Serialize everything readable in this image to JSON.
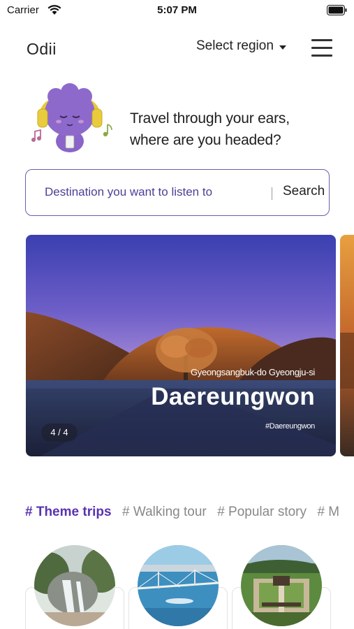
{
  "status_bar": {
    "carrier": "Carrier",
    "time": "5:07 PM",
    "wifi_icon": "wifi-icon",
    "battery_icon": "battery-icon"
  },
  "header": {
    "logo": "Odii",
    "region_select": "Select region",
    "region_icon": "caret-down-icon",
    "menu_icon": "hamburger-menu-icon"
  },
  "hero": {
    "line1": "Travel through your ears,",
    "line2": "where are you headed?",
    "mascot": "headphone-mascot-illustration"
  },
  "search": {
    "placeholder": "Destination you want to listen to",
    "button": "Search"
  },
  "featured": {
    "region": "Gyeongsangbuk-do Gyeongju-si",
    "title": "Daereungwon",
    "tag": "#Daereungwon",
    "counter": "4 / 4"
  },
  "tabs": [
    {
      "label": "# Theme trips",
      "active": true
    },
    {
      "label": "# Walking tour",
      "active": false
    },
    {
      "label": "# Popular story",
      "active": false
    },
    {
      "label": "# M",
      "active": false
    }
  ],
  "colors": {
    "accent": "#5a33b0",
    "search_border": "#6b5fa8",
    "search_text": "#4b3f96"
  }
}
